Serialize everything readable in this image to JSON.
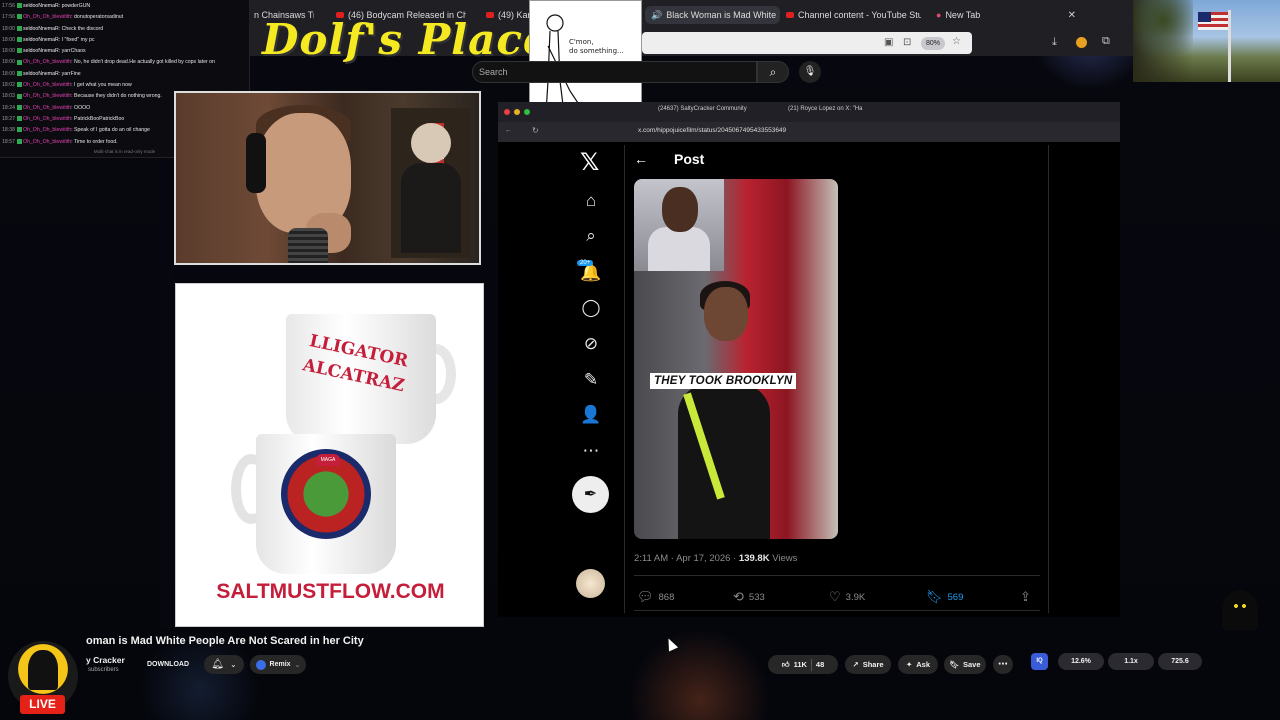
{
  "chat": {
    "lines": [
      {
        "time": "17:56",
        "user": "seldooNnemaR",
        "pink": false,
        "text": "powderGUN"
      },
      {
        "time": "17:56",
        "user": "Oh_Oh_Oh_blewitith",
        "pink": true,
        "text": "donutoperatorsadinut"
      },
      {
        "time": "18:00",
        "user": "seldooNnemaR",
        "pink": false,
        "text": "Check the discord"
      },
      {
        "time": "18:00",
        "user": "seldooNnemaR",
        "pink": false,
        "text": "I \"fixed\" my pc"
      },
      {
        "time": "18:00",
        "user": "seldooNnemaR",
        "pink": false,
        "text": "yarrChaos"
      },
      {
        "time": "18:00",
        "user": "Oh_Oh_Oh_blewitith",
        "pink": true,
        "text": "No, he didn't drop dead.He actually got killed by cops later on"
      },
      {
        "time": "18:00",
        "user": "seldooNnemaR",
        "pink": false,
        "text": "yarrFine"
      },
      {
        "time": "18:02",
        "user": "Oh_Oh_Oh_blewitith",
        "pink": true,
        "text": "I get what you mean now"
      },
      {
        "time": "18:03",
        "user": "Oh_Oh_Oh_blewitith",
        "pink": true,
        "text": "Because they didn't do nothing wrong."
      },
      {
        "time": "18:24",
        "user": "Oh_Oh_Oh_blewitith",
        "pink": true,
        "text": "OOOO"
      },
      {
        "time": "18:27",
        "user": "Oh_Oh_Oh_blewitith",
        "pink": true,
        "text": "PatrickBooPatrickBoo"
      },
      {
        "time": "18:38",
        "user": "Oh_Oh_Oh_blewitith",
        "pink": true,
        "text": "Speak of I gotta do an oil change"
      },
      {
        "time": "18:57",
        "user": "Oh_Oh_Oh_blewitith",
        "pink": true,
        "text": "Time to order food."
      }
    ],
    "footer": "Multi-chat is in read-only mode"
  },
  "browser": {
    "tabs": [
      {
        "label": "n Chainsaws Tree",
        "icon": "youtube-icon",
        "active": false
      },
      {
        "label": "(46) Bodycam Released in Chur",
        "icon": "youtube-icon",
        "active": false
      },
      {
        "label": "(49) Kar",
        "icon": "youtube-icon",
        "active": false
      },
      {
        "label": "Black Woman is Mad White",
        "icon": "speaker-icon",
        "active": true
      },
      {
        "label": "Channel content - YouTube Stu",
        "icon": "youtube-icon",
        "active": false
      },
      {
        "label": "New Tab",
        "icon": "browser-icon",
        "active": false
      }
    ],
    "zoom": "80%"
  },
  "overlay": {
    "title": "Dolf's Place",
    "comic_text": "C'mon,\ndo something..."
  },
  "yt_search": {
    "placeholder": "Search"
  },
  "ad": {
    "mug_text_1": "LLIGATOR",
    "mug_text_2": "ALCATRAZ",
    "hat_text": "MAGA",
    "url": "SALTMUSTFLOW.COM"
  },
  "capture": {
    "tabs": [
      "(24637) SaltyCracker Community",
      "(21) Royce Lopez on X: \"Ha"
    ],
    "url": "x.com/hippojuicefilm/status/2045067495433553649",
    "notif_badge": "20+",
    "post_heading": "Post",
    "video_caption": "THEY TOOK BROOKLYN",
    "post_time": "2:11 AM · Apr 17, 2026 · ",
    "post_views_count": "139.8K",
    "post_views_label": " Views",
    "replies": "868",
    "reposts": "533",
    "likes": "3.9K",
    "bookmarks": "569"
  },
  "youtube": {
    "video_title": "oman is Mad White People Are Not Scared in her City",
    "channel_name": "y Cracker",
    "subscribers": "subscribers",
    "live": "LIVE",
    "download": "DOWNLOAD",
    "remix": "Remix",
    "likes": "11K",
    "dislikes": "48",
    "share": "Share",
    "ask": "Ask",
    "save": "Save"
  },
  "stats": {
    "icon_label": "IQ",
    "a": "12.6%",
    "b": "1.1x",
    "c": "725.6"
  },
  "colors": {
    "accent_blue": "#1d9bf0",
    "yt_red": "#e62117",
    "brand_red": "#c41e3a",
    "title_yellow": "#f5ea22"
  }
}
